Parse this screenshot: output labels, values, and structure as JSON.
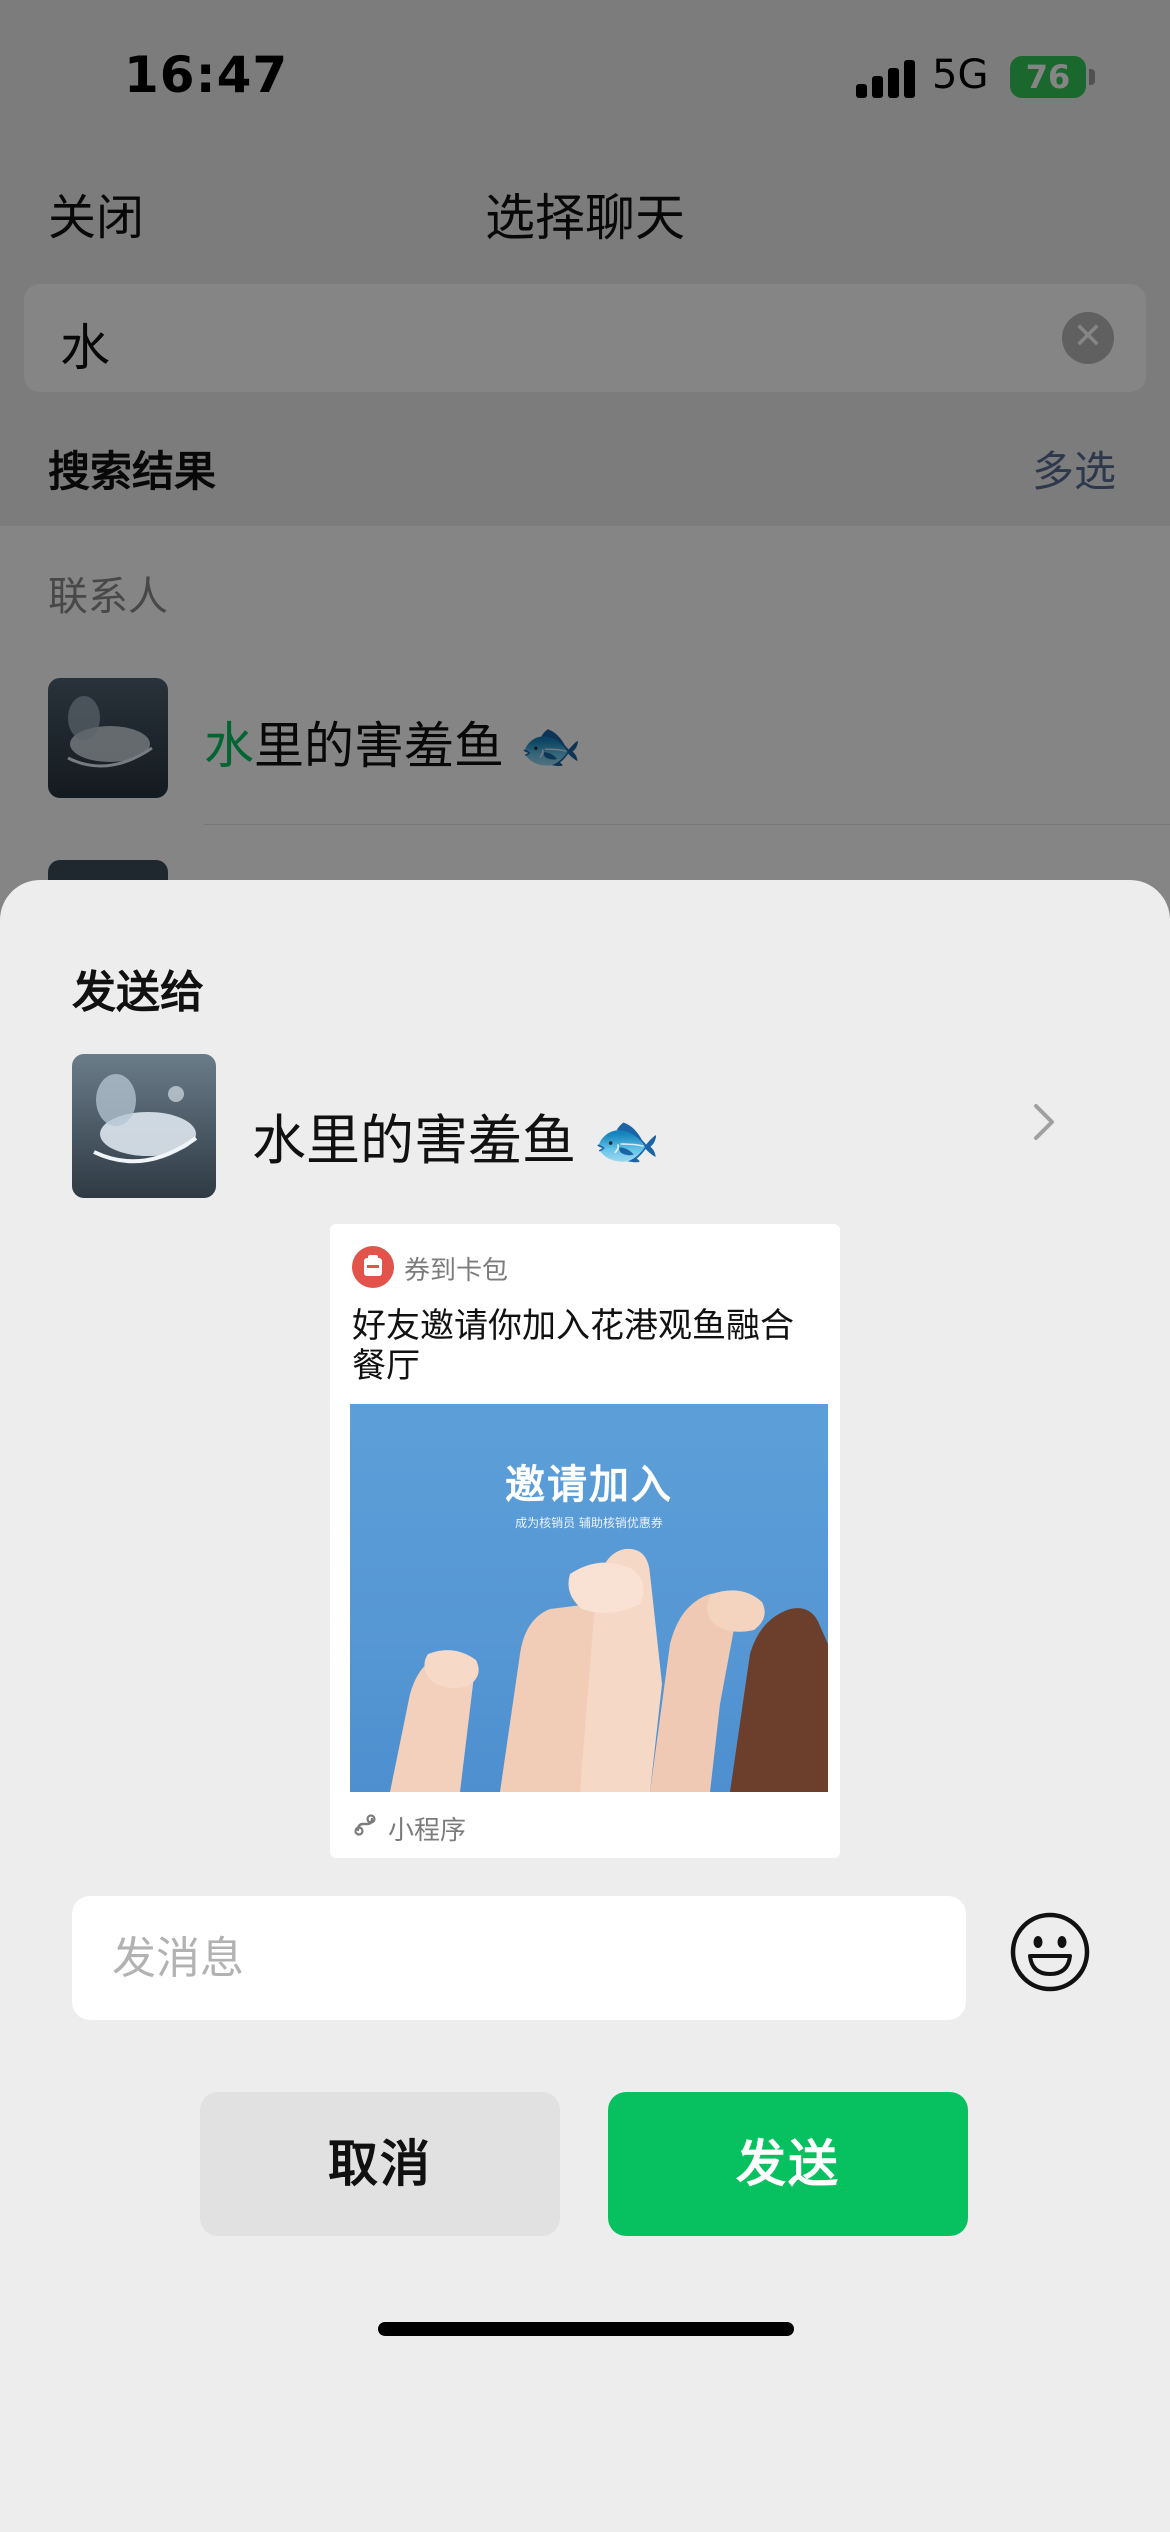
{
  "status_bar": {
    "time": "16:47",
    "network": "5G",
    "battery": "76"
  },
  "nav": {
    "close_label": "关闭",
    "title": "选择聊天"
  },
  "search": {
    "value": "水"
  },
  "results": {
    "heading": "搜索结果",
    "multiselect_label": "多选",
    "contacts_label": "联系人",
    "contacts": [
      {
        "name_highlight": "水",
        "name_rest": "里的害羞鱼 🐟"
      }
    ]
  },
  "sheet": {
    "heading": "发送给",
    "recipient_name": "水里的害羞鱼 🐟",
    "card": {
      "source": "券到卡包",
      "title": "好友邀请你加入花港观鱼融合餐厅",
      "image_title": "邀请加入",
      "image_subtitle": "成为核销员 辅助核销优惠券",
      "footer": "小程序"
    },
    "message_placeholder": "发消息",
    "cancel_label": "取消",
    "send_label": "发送"
  },
  "colors": {
    "accent_green": "#07c160",
    "link_blue": "#576b95"
  }
}
